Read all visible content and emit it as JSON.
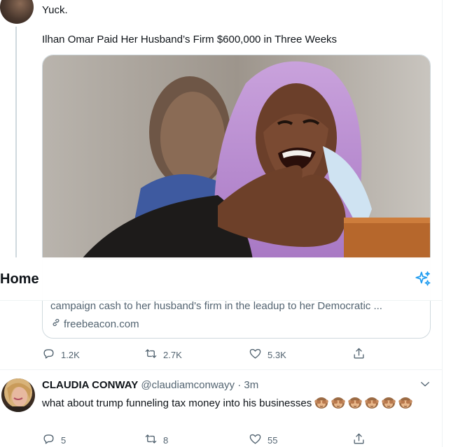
{
  "tweet1": {
    "text": "Yuck.",
    "link_card": {
      "headline": "Ilhan Omar Paid Her Husband’s Firm $600,000 in Three Weeks",
      "description": "campaign cash to her husband's firm in the leadup to her Democratic ...",
      "domain": "freebeacon.com"
    },
    "actions": {
      "replies": "1.2K",
      "retweets": "2.7K",
      "likes": "5.3K"
    }
  },
  "header": {
    "title": "Home"
  },
  "tweet2": {
    "author_name": "CLAUDIA CONWAY",
    "author_handle": "@claudiamconwayy",
    "separator": "·",
    "time": "3m",
    "text": "what about trump funneling tax money into his businesses",
    "emoji_count": 6,
    "actions": {
      "replies": "5",
      "retweets": "8",
      "likes": "55"
    }
  },
  "colors": {
    "text_primary": "#0f1419",
    "text_secondary": "#536471",
    "accent": "#1d9bf0",
    "border": "#cfd9de"
  },
  "icons": [
    "reply-icon",
    "retweet-icon",
    "like-icon",
    "share-icon",
    "sparkle-icon",
    "link-icon",
    "chevron-down-icon",
    "see-no-evil-monkey-emoji"
  ]
}
